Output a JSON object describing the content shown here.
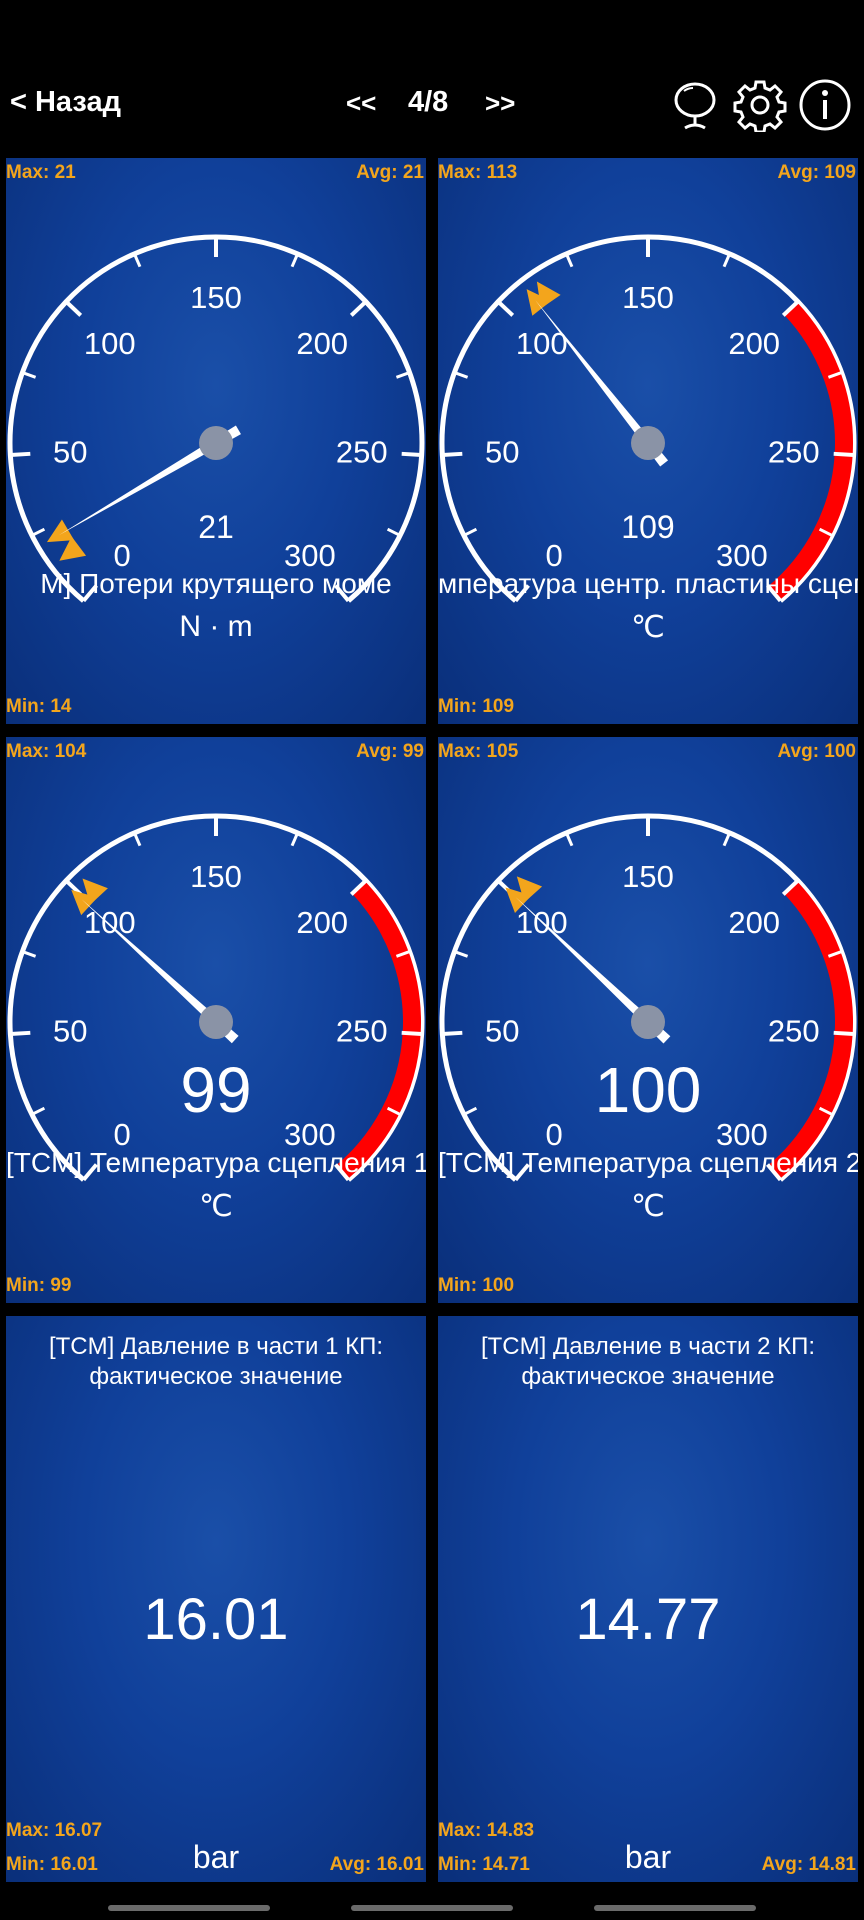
{
  "header": {
    "back_label": "< Назад",
    "prev_label": "<<",
    "next_label": ">>",
    "page_indicator": "4/8",
    "icons": [
      "mirror-icon",
      "gear-icon",
      "info-icon"
    ]
  },
  "colors": {
    "panel": "#10409a",
    "stat": "#f3a51c",
    "redzone": "#ff0000",
    "needle": "#ffffff",
    "hub": "#8a93a6"
  },
  "gauges": [
    {
      "max_label": "Max: 21",
      "avg_label": "Avg: 21",
      "min_label": "Min: 14",
      "title": "M] Потери крутящего моме",
      "unit": "N · m",
      "value": 21,
      "value_label": "21",
      "value_large": false,
      "min_mark": 14,
      "max_mark": 21,
      "redzone": null,
      "scale_labels": [
        "0",
        "50",
        "100",
        "150",
        "200",
        "250",
        "300"
      ]
    },
    {
      "max_label": "Max: 113",
      "avg_label": "Avg: 109",
      "min_label": "Min: 109",
      "title": "мпература центр. пластины сцеплен",
      "unit": "℃",
      "value": 109,
      "value_label": "109",
      "value_large": false,
      "min_mark": 109,
      "max_mark": 113,
      "redzone": [
        200,
        300
      ],
      "scale_labels": [
        "0",
        "50",
        "100",
        "150",
        "200",
        "250",
        "300"
      ]
    },
    {
      "max_label": "Max: 104",
      "avg_label": "Avg: 99",
      "min_label": "Min: 99",
      "title": "[TCM] Температура сцепления 1",
      "unit": "℃",
      "value": 99,
      "value_label": "99",
      "value_large": true,
      "min_mark": 99,
      "max_mark": 104,
      "redzone": [
        200,
        300
      ],
      "scale_labels": [
        "0",
        "50",
        "100",
        "150",
        "200",
        "250",
        "300"
      ]
    },
    {
      "max_label": "Max: 105",
      "avg_label": "Avg: 100",
      "min_label": "Min: 100",
      "title": "[TCM] Температура сцепления 2",
      "unit": "℃",
      "value": 100,
      "value_label": "100",
      "value_large": true,
      "min_mark": 100,
      "max_mark": 105,
      "redzone": [
        200,
        300
      ],
      "scale_labels": [
        "0",
        "50",
        "100",
        "150",
        "200",
        "250",
        "300"
      ]
    }
  ],
  "digitals": [
    {
      "title": "[TCM] Давление в части 1 КП: фактическое значение",
      "value": "16.01",
      "unit": "bar",
      "max_label": "Max: 16.07",
      "min_label": "Min: 16.01",
      "avg_label": "Avg: 16.01"
    },
    {
      "title": "[TCM] Давление в части 2 КП: фактическое значение",
      "value": "14.77",
      "unit": "bar",
      "max_label": "Max: 14.83",
      "min_label": "Min: 14.71",
      "avg_label": "Avg: 14.81"
    }
  ]
}
